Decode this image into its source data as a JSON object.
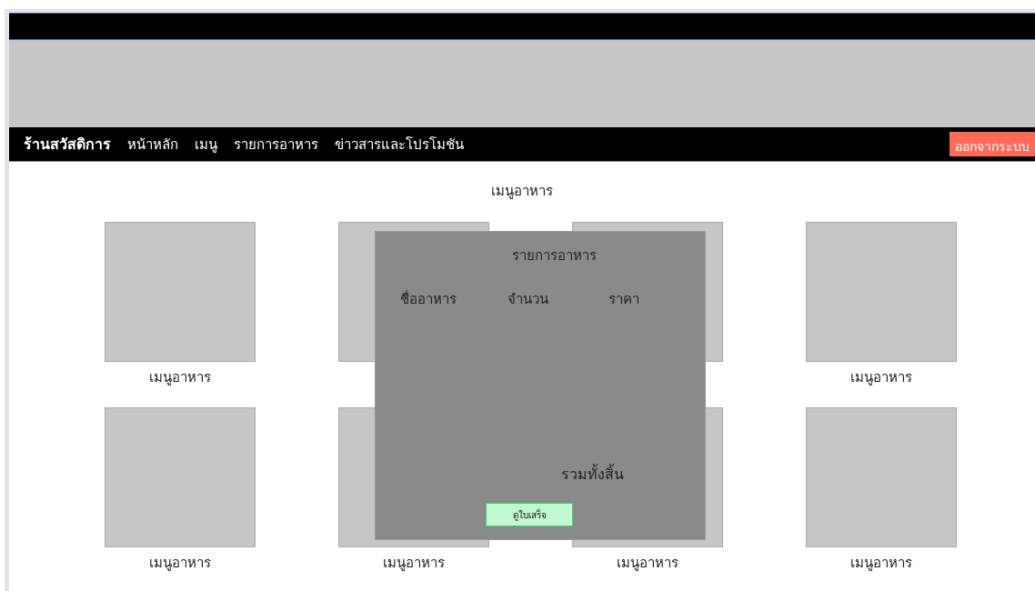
{
  "navbar": {
    "brand": "ร้านสวัสดิการ",
    "items": [
      "หน้าหลัก",
      "เมนู",
      "รายการอาหาร",
      "ข่าวสารและโปรโมชัน"
    ],
    "logout": "ออกจากระบบ"
  },
  "page_title": "เมนูอาหาร",
  "menu_items": [
    {
      "kind": "picture",
      "label": "เมนูอาหาร"
    },
    {
      "kind": "picture"
    },
    {
      "kind": "picture"
    },
    {
      "kind": "picture",
      "label": "เมนูอาหาร"
    },
    {
      "kind": "picture",
      "label": "เมนูอาหาร"
    },
    {
      "kind": "picture",
      "label": "เมนูอาหาร"
    },
    {
      "kind": "picture",
      "label": "เมนูอาหาร"
    },
    {
      "kind": "picture",
      "label": "เมนูอาหาร"
    }
  ],
  "order_dialog": {
    "title": "รายการอาหาร",
    "columns": [
      "ชื่ออาหาร",
      "จำนวน",
      "ราคา"
    ],
    "total_label": "รวมทั้งสิ้น",
    "button": "ดูใบเสร็จ"
  }
}
